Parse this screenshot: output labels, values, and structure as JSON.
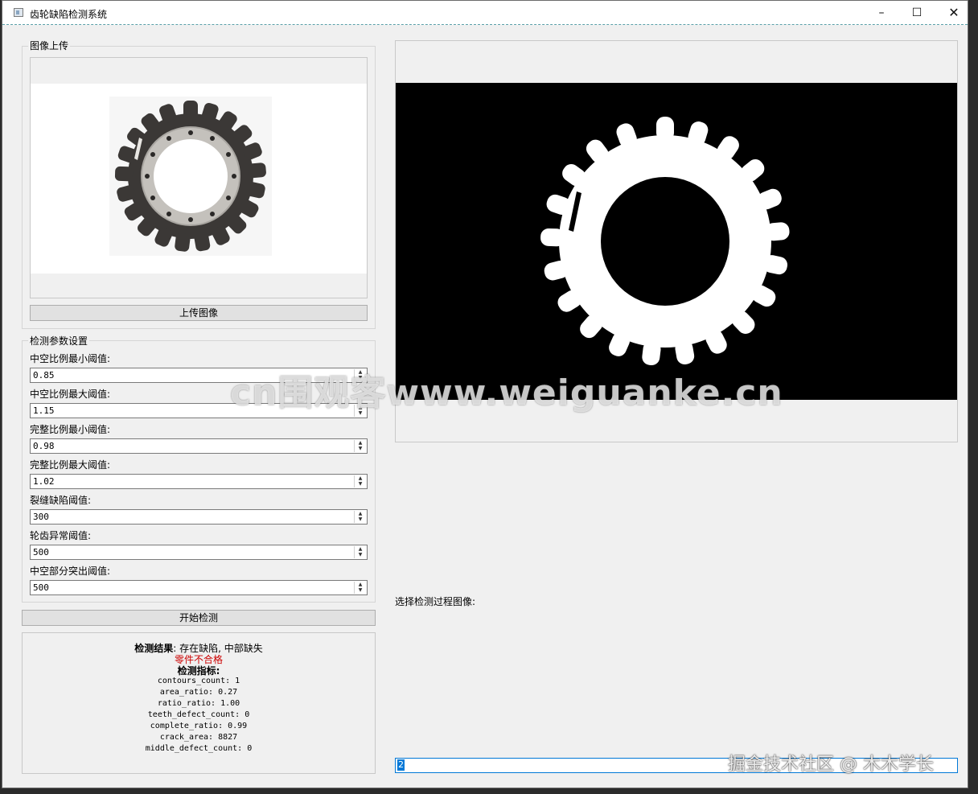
{
  "window": {
    "title": "齿轮缺陷检测系统",
    "minimize_glyph": "–",
    "maximize_glyph": "☐",
    "close_glyph": "✕"
  },
  "upload_group": {
    "title": "图像上传",
    "upload_button": "上传图像"
  },
  "params_group": {
    "title": "检测参数设置",
    "params": [
      {
        "label": "中空比例最小阈值:",
        "value": "0.85"
      },
      {
        "label": "中空比例最大阈值:",
        "value": "1.15"
      },
      {
        "label": "完整比例最小阈值:",
        "value": "0.98"
      },
      {
        "label": "完整比例最大阈值:",
        "value": "1.02"
      },
      {
        "label": "裂缝缺陷阈值:",
        "value": "300"
      },
      {
        "label": "轮齿异常阈值:",
        "value": "500"
      },
      {
        "label": "中空部分突出阈值:",
        "value": "500"
      }
    ]
  },
  "start_button": "开始检测",
  "result": {
    "result_label": "检测结果",
    "result_text": ": 存在缺陷, 中部缺失",
    "verdict": "零件不合格",
    "metrics_title": "检测指标:",
    "metrics": [
      "contours_count: 1",
      "area_ratio: 0.27",
      "ratio_ratio: 1.00",
      "teeth_defect_count: 0",
      "complete_ratio: 0.99",
      "crack_area: 8827",
      "middle_defect_count: 0"
    ]
  },
  "process_selector": {
    "label": "选择检测过程图像:",
    "value": "2"
  },
  "watermarks": {
    "center": "cn围观客www.weiguanke.cn",
    "corner": "掘金技术社区 @ 木木学长"
  },
  "colors": {
    "verdict": "#cc0000",
    "selection": "#0078d7"
  }
}
